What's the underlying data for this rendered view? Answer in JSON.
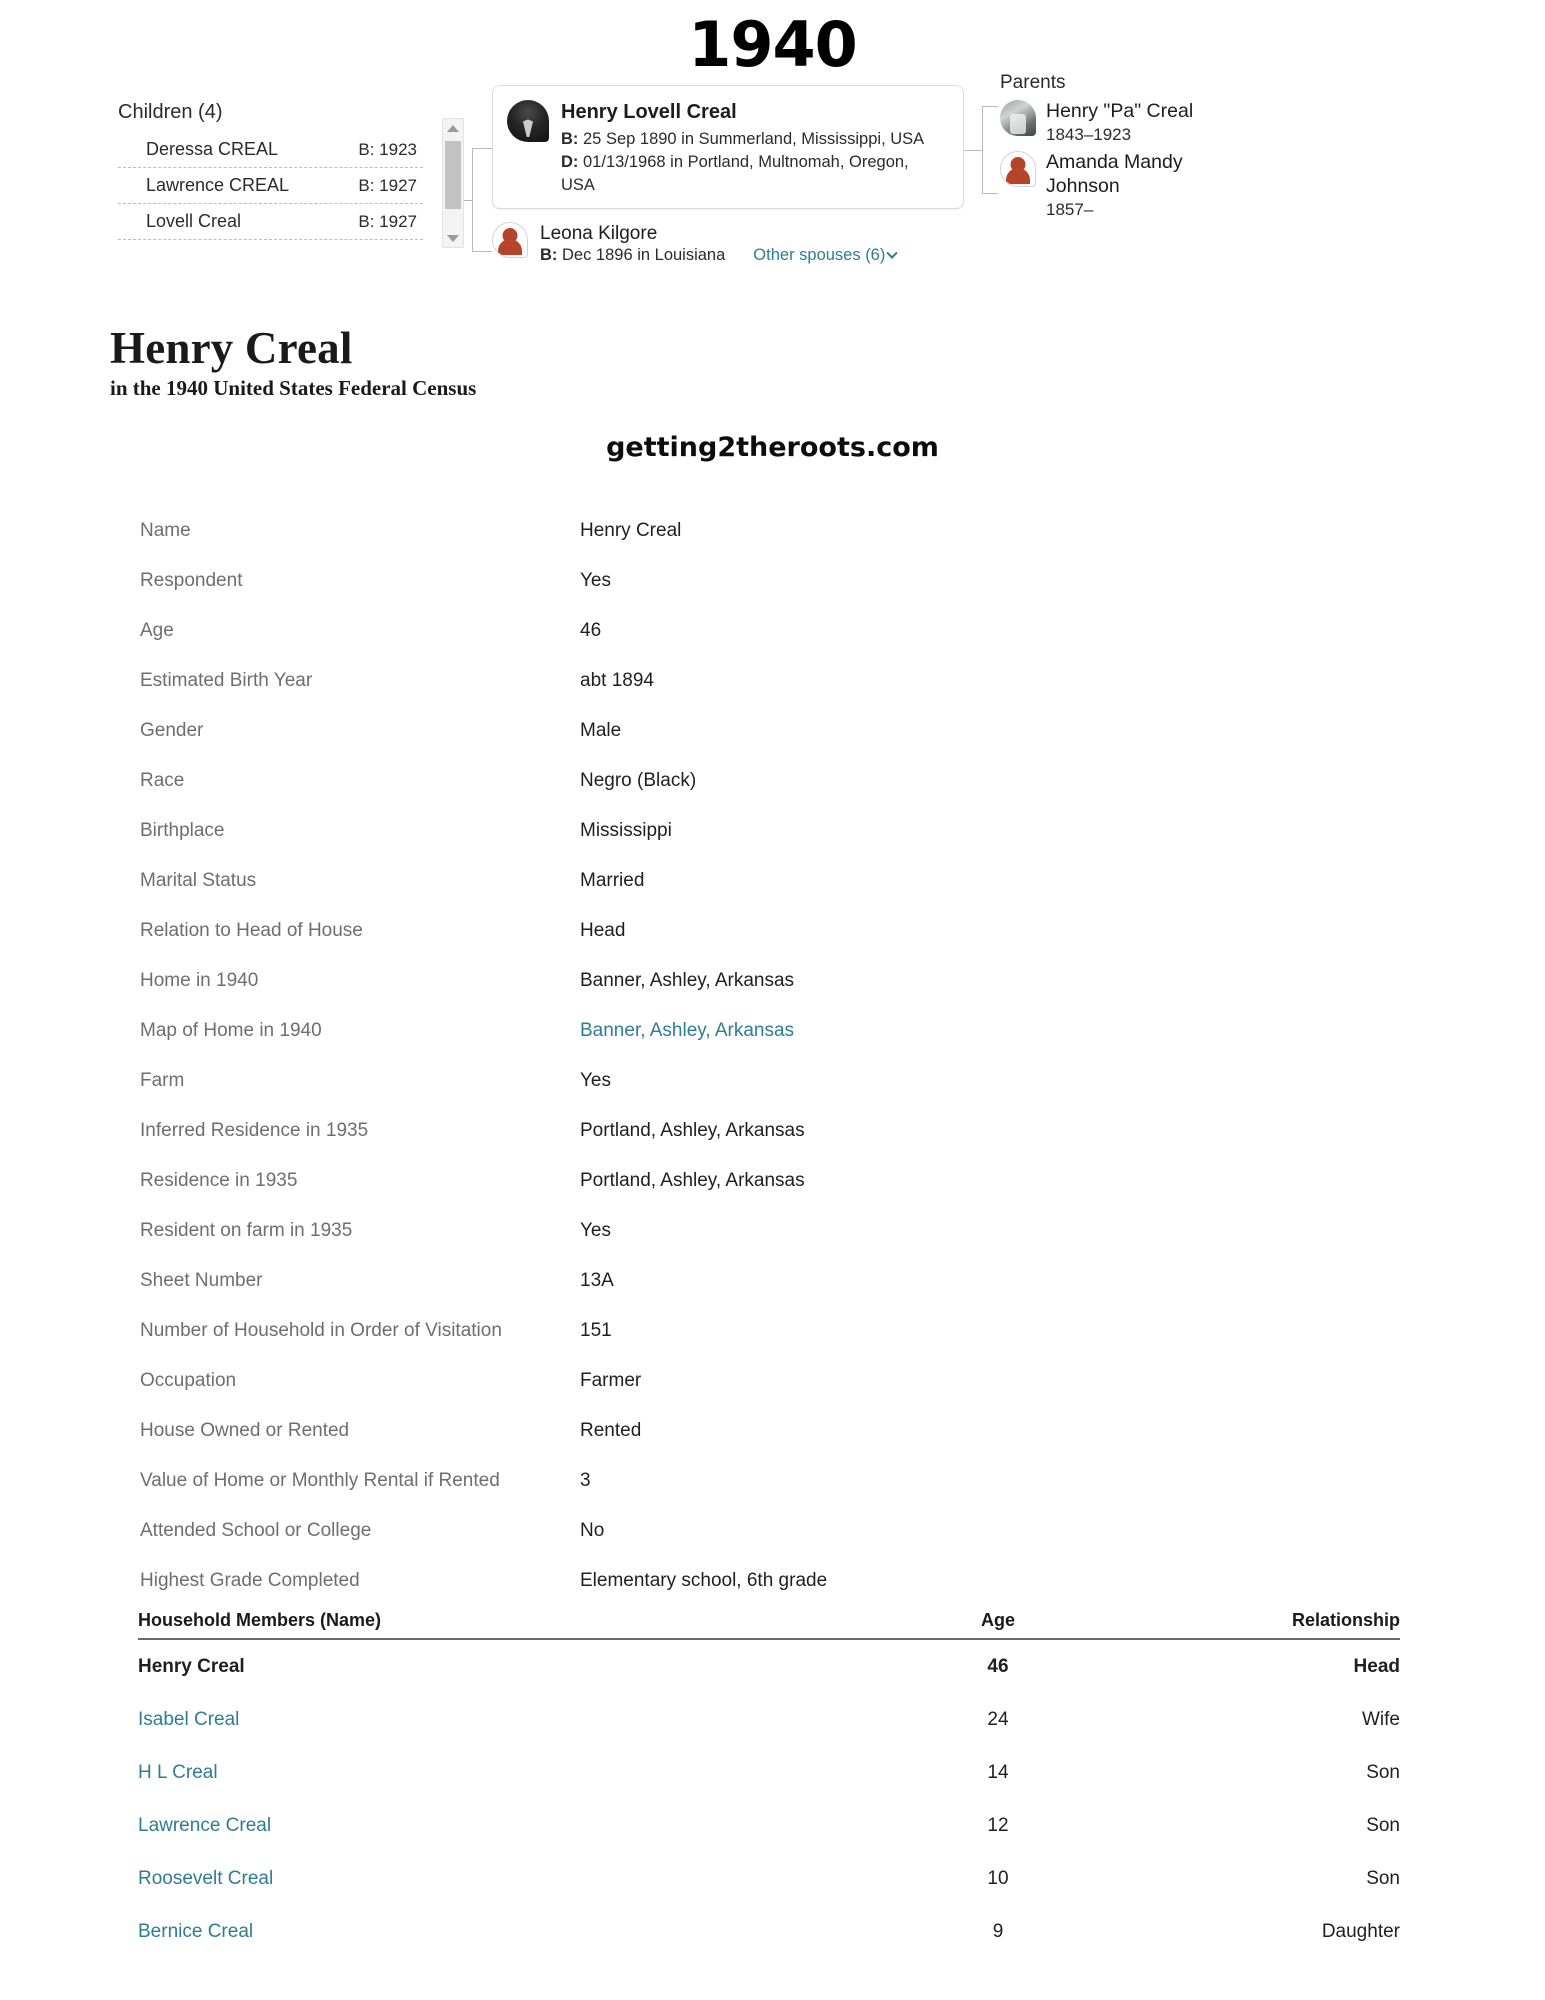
{
  "tree": {
    "year_title": "1940",
    "children": {
      "heading": "Children (4)",
      "items": [
        {
          "name": "Deressa CREAL",
          "birth": "B: 1923"
        },
        {
          "name": "Lawrence CREAL",
          "birth": "B: 1927"
        },
        {
          "name": "Lovell Creal",
          "birth": "B: 1927"
        }
      ]
    },
    "focus": {
      "name": "Henry Lovell Creal",
      "birth_label": "B:",
      "birth_value": " 25 Sep 1890 in Summerland, Mississippi, USA",
      "death_label": "D:",
      "death_value": " 01/13/1968 in Portland, Multnomah, Oregon, USA"
    },
    "spouse": {
      "name": "Leona Kilgore",
      "birth_label": "B:",
      "birth_value": " Dec 1896 in Louisiana",
      "other_spouses": "Other spouses (6)"
    },
    "parents": {
      "heading": "Parents",
      "items": [
        {
          "name": "Henry \"Pa\" Creal",
          "dates": "1843–1923"
        },
        {
          "name": "Amanda Mandy Johnson",
          "dates": "1857–"
        }
      ]
    }
  },
  "record": {
    "title": "Henry Creal",
    "subtitle": "in the 1940 United States Federal Census",
    "watermark": "getting2theroots.com"
  },
  "details": [
    {
      "label": "Name",
      "value": "Henry Creal",
      "link": false
    },
    {
      "label": "Respondent",
      "value": "Yes",
      "link": false
    },
    {
      "label": "Age",
      "value": "46",
      "link": false
    },
    {
      "label": "Estimated Birth Year",
      "value": "abt 1894",
      "link": false
    },
    {
      "label": "Gender",
      "value": "Male",
      "link": false
    },
    {
      "label": "Race",
      "value": "Negro (Black)",
      "link": false
    },
    {
      "label": "Birthplace",
      "value": "Mississippi",
      "link": false
    },
    {
      "label": "Marital Status",
      "value": "Married",
      "link": false
    },
    {
      "label": "Relation to Head of House",
      "value": "Head",
      "link": false
    },
    {
      "label": "Home in 1940",
      "value": "Banner, Ashley, Arkansas",
      "link": false
    },
    {
      "label": "Map of Home in 1940",
      "value": "Banner, Ashley, Arkansas",
      "link": true
    },
    {
      "label": "Farm",
      "value": "Yes",
      "link": false
    },
    {
      "label": "Inferred Residence in 1935",
      "value": "Portland, Ashley, Arkansas",
      "link": false
    },
    {
      "label": "Residence in 1935",
      "value": "Portland, Ashley, Arkansas",
      "link": false
    },
    {
      "label": "Resident on farm in 1935",
      "value": "Yes",
      "link": false
    },
    {
      "label": "Sheet Number",
      "value": "13A",
      "link": false
    },
    {
      "label": "Number of Household in Order of Visitation",
      "value": "151",
      "link": false
    },
    {
      "label": "Occupation",
      "value": "Farmer",
      "link": false
    },
    {
      "label": "House Owned or Rented",
      "value": "Rented",
      "link": false
    },
    {
      "label": "Value of Home or Monthly Rental if Rented",
      "value": "3",
      "link": false
    },
    {
      "label": "Attended School or College",
      "value": "No",
      "link": false
    },
    {
      "label": "Highest Grade Completed",
      "value": "Elementary school, 6th grade",
      "link": false
    }
  ],
  "household": {
    "columns": {
      "name": "Household Members (Name)",
      "age": "Age",
      "relationship": "Relationship"
    },
    "rows": [
      {
        "name": "Henry Creal",
        "age": "46",
        "relationship": "Head",
        "link": false,
        "bold": true
      },
      {
        "name": "Isabel Creal",
        "age": "24",
        "relationship": "Wife",
        "link": true,
        "bold": false
      },
      {
        "name": "H L Creal",
        "age": "14",
        "relationship": "Son",
        "link": true,
        "bold": false
      },
      {
        "name": "Lawrence Creal",
        "age": "12",
        "relationship": "Son",
        "link": true,
        "bold": false
      },
      {
        "name": "Roosevelt Creal",
        "age": "10",
        "relationship": "Son",
        "link": true,
        "bold": false
      },
      {
        "name": "Bernice Creal",
        "age": "9",
        "relationship": "Daughter",
        "link": true,
        "bold": false
      }
    ]
  },
  "colors": {
    "link": "#2d7d93",
    "label": "#6e6e6e",
    "text": "#1f1f1f"
  }
}
